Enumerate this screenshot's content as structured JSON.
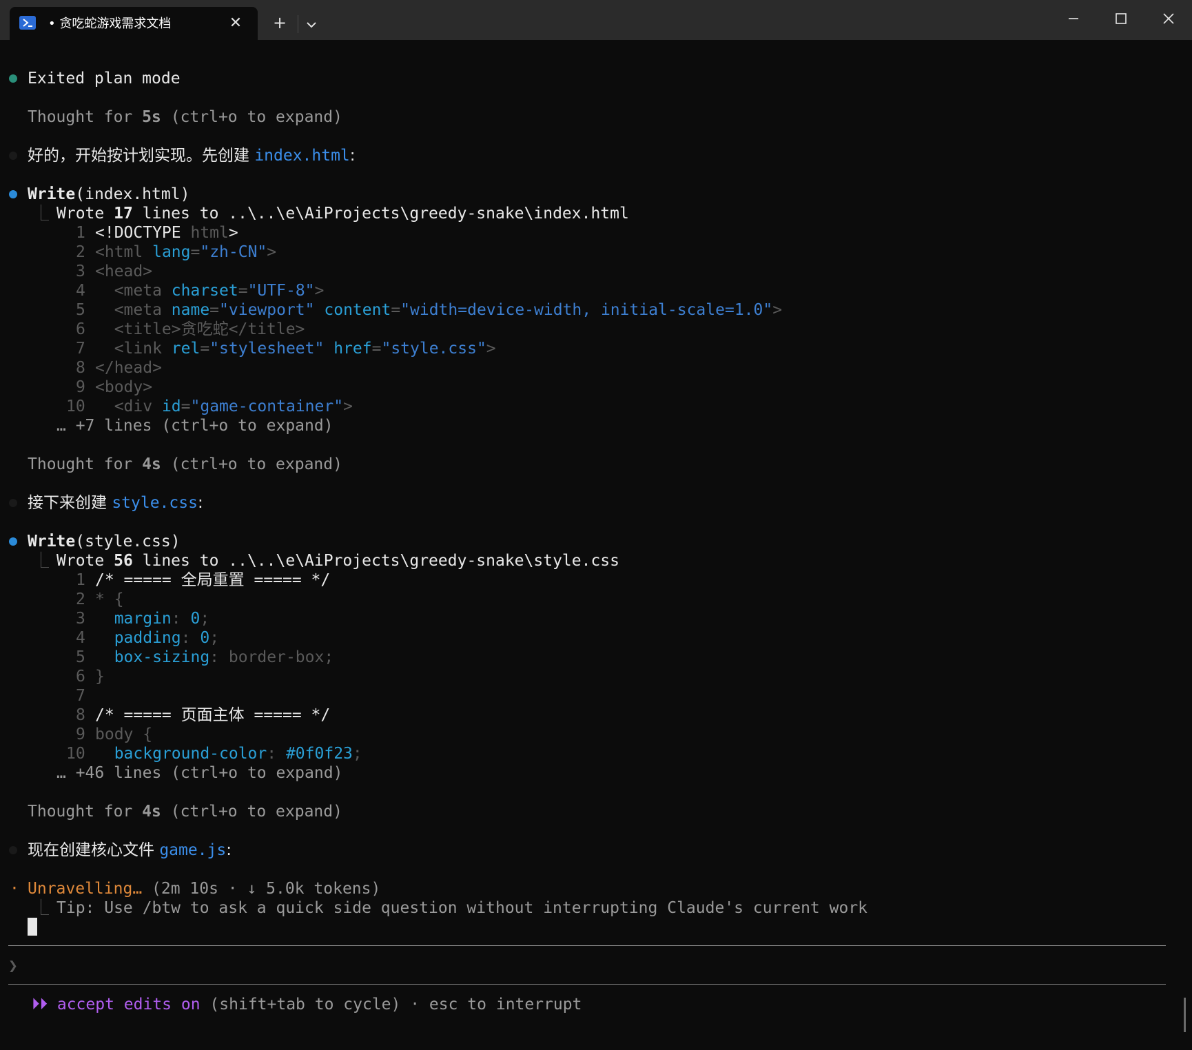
{
  "window": {
    "tab_title": "• 贪吃蛇游戏需求文档",
    "icons": [
      "powershell-icon",
      "close-icon",
      "plus-icon",
      "chevron-down-icon",
      "minimize-icon",
      "maximize-icon",
      "close-window-icon"
    ]
  },
  "colors": {
    "background": "#0c0c0c",
    "titlebar": "#2b2b2b",
    "accent_blue": "#3b8eea",
    "accent_orange": "#e0893a",
    "accent_purple": "#b15ef0",
    "bullet_teal": "#2a8f7a"
  },
  "terminal": {
    "exited": "Exited plan mode",
    "thought1_pre": "Thought for ",
    "thought1_val": "5s",
    "thought1_post": " (ctrl+o to expand)",
    "msg1_text": "好的，开始按计划实现。先创建 ",
    "msg1_file": "index.html",
    "msg1_tail": ":",
    "write1_name": "Write",
    "write1_arg": "(index.html)",
    "wrote1_pre": "Wrote ",
    "wrote1_count": "17",
    "wrote1_post": " lines to ..\\..\\e\\AiProjects\\greedy-snake\\index.html",
    "html_lines": {
      "n1": "1",
      "n2": "2",
      "n3": "3",
      "n4": "4",
      "n5": "5",
      "n6": "6",
      "n7": "7",
      "n8": "8",
      "n9": "9",
      "n10": "10",
      "l1a": "<!DOCTYPE ",
      "l1b": "html",
      "l1c": ">",
      "l2a": "<html ",
      "l2b": "lang",
      "l2c": "=",
      "l2d": "\"zh-CN\"",
      "l2e": ">",
      "l3": "<head>",
      "l4a": "  <meta ",
      "l4b": "charset",
      "l4c": "=",
      "l4d": "\"UTF-8\"",
      "l4e": ">",
      "l5a": "  <meta ",
      "l5b": "name",
      "l5c": "=",
      "l5d": "\"viewport\"",
      "l5e": " ",
      "l5f": "content",
      "l5g": "=",
      "l5h": "\"width=device-width, initial-scale=1.0\"",
      "l5i": ">",
      "l6": "  <title>贪吃蛇</title>",
      "l7a": "  <link ",
      "l7b": "rel",
      "l7c": "=",
      "l7d": "\"stylesheet\"",
      "l7e": " ",
      "l7f": "href",
      "l7g": "=",
      "l7h": "\"style.css\"",
      "l7i": ">",
      "l8": "</head>",
      "l9": "<body>",
      "l10a": "  <div ",
      "l10b": "id",
      "l10c": "=",
      "l10d": "\"game-container\"",
      "l10e": ">"
    },
    "more1": "… +7 lines (ctrl+o to expand)",
    "thought2_pre": "Thought for ",
    "thought2_val": "4s",
    "thought2_post": " (ctrl+o to expand)",
    "msg2_text": "接下来创建 ",
    "msg2_file": "style.css",
    "msg2_tail": ":",
    "write2_name": "Write",
    "write2_arg": "(style.css)",
    "wrote2_pre": "Wrote ",
    "wrote2_count": "56",
    "wrote2_post": " lines to ..\\..\\e\\AiProjects\\greedy-snake\\style.css",
    "css_lines": {
      "n1": "1",
      "n2": "2",
      "n3": "3",
      "n4": "4",
      "n5": "5",
      "n6": "6",
      "n7": "7",
      "n8": "8",
      "n9": "9",
      "n10": "10",
      "l1": "/* ===== 全局重置 ===== */",
      "l2": "* {",
      "l3a": "  margin",
      "l3b": ": ",
      "l3c": "0",
      "l3d": ";",
      "l4a": "  padding",
      "l4b": ": ",
      "l4c": "0",
      "l4d": ";",
      "l5a": "  box-sizing",
      "l5b": ": border-box;",
      "l6": "}",
      "l8": "/* ===== 页面主体 ===== */",
      "l9": "body {",
      "l10a": "  background-color",
      "l10b": ": ",
      "l10c": "#0f0f23",
      "l10d": ";"
    },
    "more2": "… +46 lines (ctrl+o to expand)",
    "thought3_pre": "Thought for ",
    "thought3_val": "4s",
    "thought3_post": " (ctrl+o to expand)",
    "msg3_text": "现在创建核心文件 ",
    "msg3_file": "game.js",
    "msg3_tail": ":",
    "status_star": "·",
    "status_word": "Unravelling…",
    "status_meta": " (2m 10s · ↓ 5.0k tokens)",
    "tip": "Tip: Use /btw to ask a quick side question without interrupting Claude's current work",
    "prompt_symbol": "❯",
    "mode_arrows": "⏵⏵",
    "mode_label": "accept edits on",
    "mode_hint": " (shift+tab to cycle) · esc to interrupt"
  }
}
